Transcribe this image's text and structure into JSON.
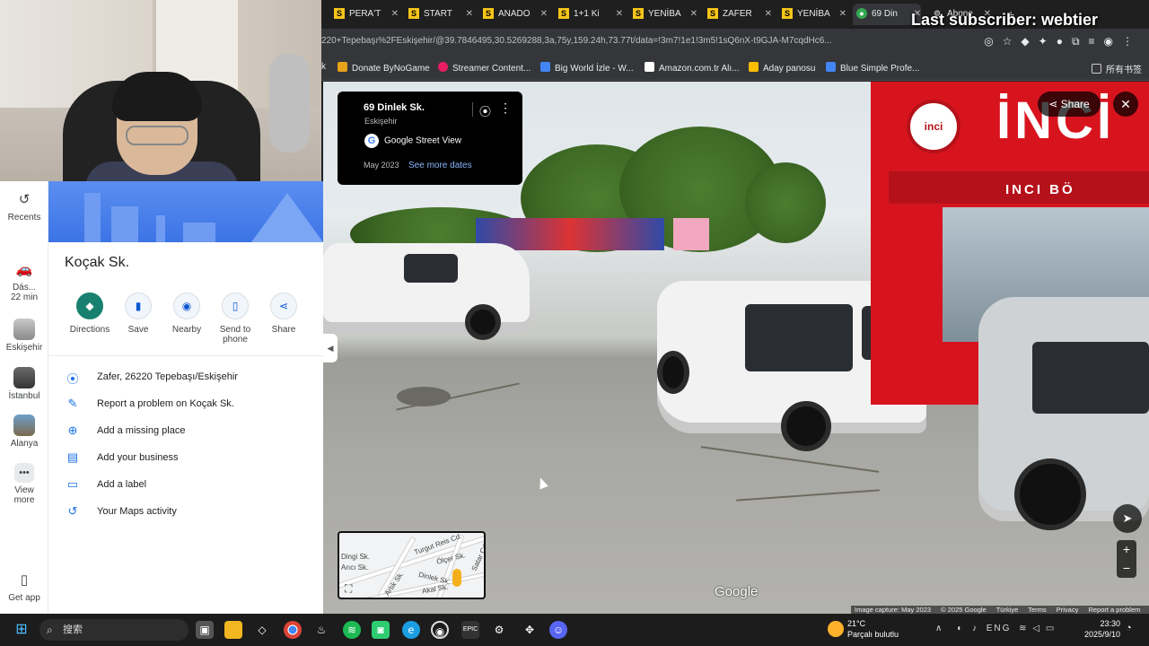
{
  "overlay": {
    "last_subscriber": "Last subscriber: webtier"
  },
  "browser": {
    "tabs": [
      {
        "label": "PERA'T",
        "icon": "S"
      },
      {
        "label": "START",
        "icon": "S"
      },
      {
        "label": "ANADO",
        "icon": "S"
      },
      {
        "label": "1+1 Ki",
        "icon": "S"
      },
      {
        "label": "YENİBA",
        "icon": "S"
      },
      {
        "label": "ZAFER",
        "icon": "S"
      },
      {
        "label": "YENİBA",
        "icon": "S"
      },
      {
        "label": "69 Din",
        "icon": "maps-pin-icon",
        "active": true
      },
      {
        "label": "Abone",
        "icon": "gear-icon"
      }
    ],
    "new_tab": "+",
    "url": "220+Tepebaşı%2FEskişehir/@39.7846495,30.5269288,3a,75y,159.24h,73.77t/data=!3m7!1e1!3m5!1sQ6nX-t9GJA-M7cqdHc6...",
    "bookmarks": [
      {
        "label": "k",
        "color": ""
      },
      {
        "label": "Donate ByNoGame",
        "color": "#e6a21a"
      },
      {
        "label": "Streamer Content...",
        "color": "#e91e63"
      },
      {
        "label": "Big World İzle - W...",
        "color": "#4285f4"
      },
      {
        "label": "Amazon.com.tr Alı...",
        "color": "#ffffff"
      },
      {
        "label": "Aday panosu",
        "color": "#fbbc04"
      },
      {
        "label": "Blue Simple Profe...",
        "color": "#4285f4"
      }
    ],
    "bookmarks_folder": "所有书签"
  },
  "rail": {
    "items": [
      {
        "label": "Recents",
        "icon": "history-icon"
      },
      {
        "label": "Dás.\n22 min",
        "line1": "Dás...",
        "line2": "22 min",
        "icon": "car-icon"
      },
      {
        "label": "Eskişehir",
        "icon": "thumbnail"
      },
      {
        "label": "İstanbul",
        "icon": "thumbnail"
      },
      {
        "label": "Alanya",
        "icon": "thumbnail"
      },
      {
        "line1": "View",
        "line2": "more",
        "icon": "more-icon"
      }
    ],
    "get_app": "Get app"
  },
  "place": {
    "title": "Koçak Sk.",
    "actions": [
      {
        "label": "Directions",
        "icon": "directions-icon"
      },
      {
        "label": "Save",
        "icon": "bookmark-icon"
      },
      {
        "label": "Nearby",
        "icon": "nearby-icon"
      },
      {
        "label_1": "Send to",
        "label_2": "phone",
        "icon": "phone-icon"
      },
      {
        "label": "Share",
        "icon": "share-icon"
      }
    ],
    "rows": [
      {
        "text": "Zafer, 26220 Tepebaşı/Eskişehir",
        "icon": "location-pin-icon"
      },
      {
        "text": "Report a problem on Koçak Sk.",
        "icon": "pencil-icon"
      },
      {
        "text": "Add a missing place",
        "icon": "add-place-icon"
      },
      {
        "text": "Add your business",
        "icon": "business-icon"
      },
      {
        "text": "Add a label",
        "icon": "label-icon"
      },
      {
        "text": "Your Maps activity",
        "icon": "history-icon"
      }
    ]
  },
  "streetview": {
    "card": {
      "title": "69 Dinlek Sk.",
      "subtitle": "Eskişehir",
      "source": "Google Street View",
      "date": "May 2023",
      "more_dates": "See more dates"
    },
    "share": "Share",
    "close": "✕",
    "shop_logo": "inci",
    "shop_sign_1": "İNCİ",
    "shop_sign_2": "INCI BÖ",
    "watermark": "Google",
    "minimap_labels": [
      "Dingi Sk.",
      "Arıcı Sk.",
      "Turgut Reis Cd.",
      "Ölçer Sk.",
      "Satar Cd.",
      "Dinlek Sk.",
      "Akal Sk.",
      "Artık Sk."
    ],
    "footer": [
      "Image capture: May 2023",
      "© 2025 Google",
      "Türkiye",
      "Terms",
      "Privacy",
      "Report a problem"
    ]
  },
  "taskbar": {
    "search": "搜索",
    "weather_temp": "21°C",
    "weather_desc": "Parçalı bulutlu",
    "lang": "ENG",
    "time": "23:30",
    "date": "2025/9/10"
  }
}
